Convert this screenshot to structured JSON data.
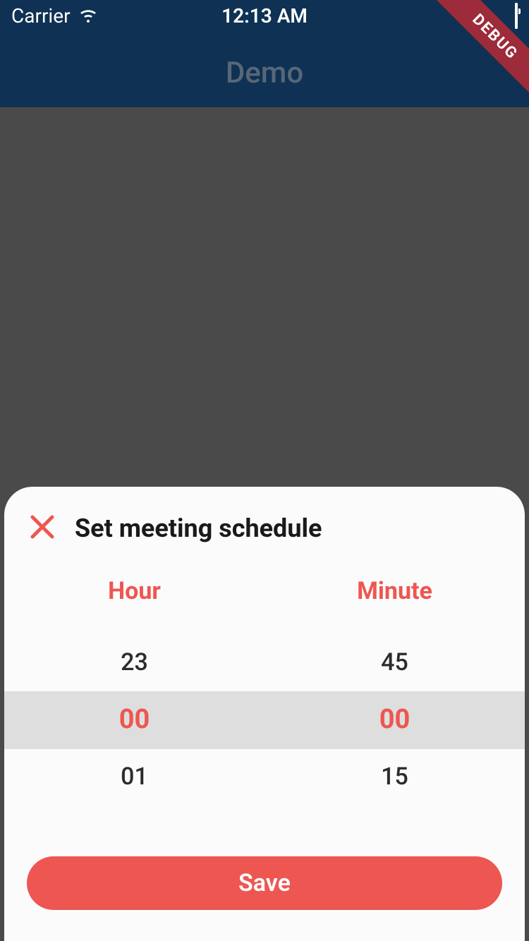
{
  "status": {
    "carrier": "Carrier",
    "time": "12:13 AM"
  },
  "app": {
    "title": "Demo"
  },
  "debug_banner": "DEBUG",
  "sheet": {
    "title": "Set meeting schedule",
    "hour_label": "Hour",
    "minute_label": "Minute",
    "hours": {
      "prev": "23",
      "selected": "00",
      "next": "01"
    },
    "minutes": {
      "prev": "45",
      "selected": "00",
      "next": "15"
    },
    "save_label": "Save"
  },
  "colors": {
    "accent": "#ee5651",
    "appbar": "#1a5590",
    "debug": "#9d2b3a"
  }
}
